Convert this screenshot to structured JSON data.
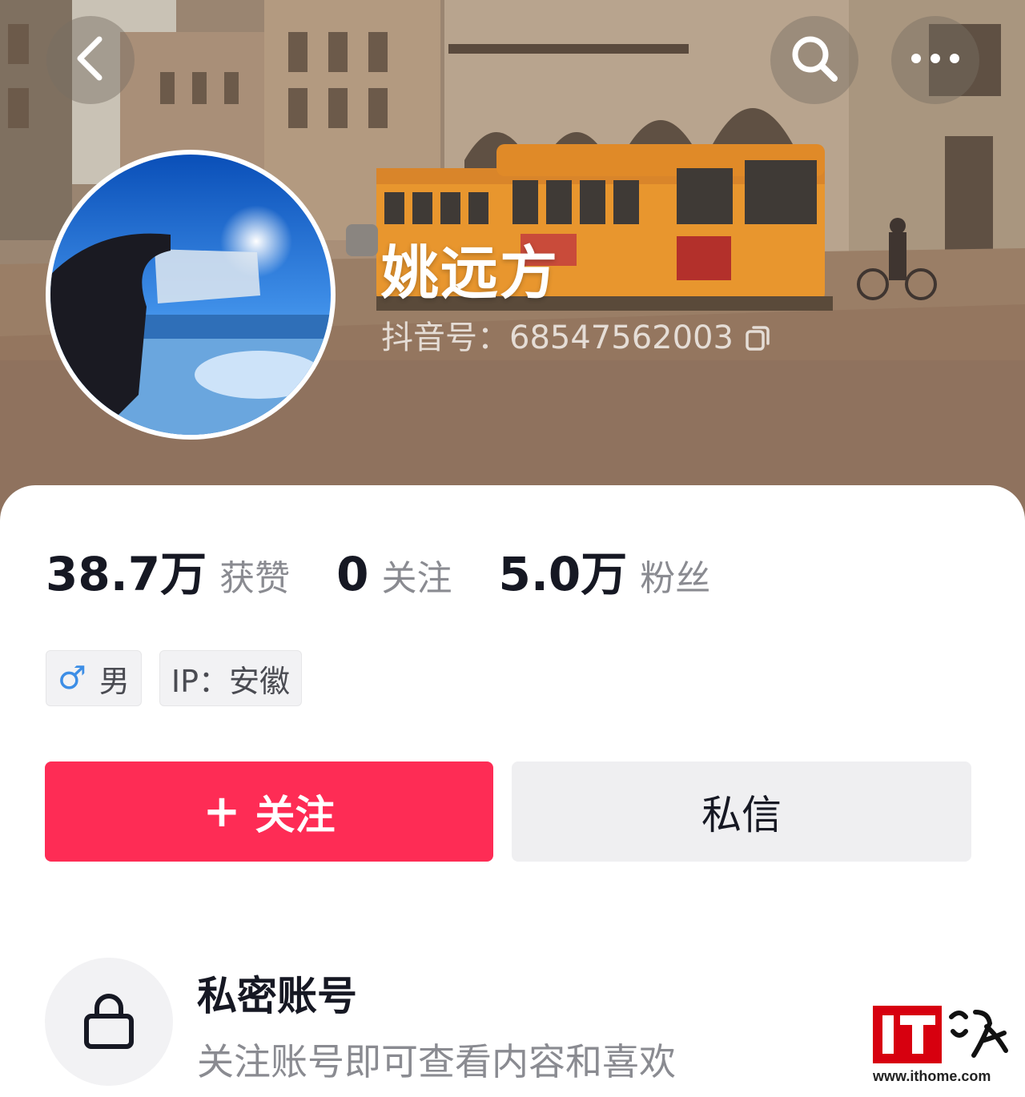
{
  "header": {
    "back_icon": "chevron-left-icon",
    "search_icon": "search-icon",
    "more_icon": "more-dots-icon"
  },
  "profile": {
    "nickname": "姚远方",
    "douyin_id": "抖音号：68547562003",
    "copy_icon": "copy-icon"
  },
  "stats": [
    {
      "value": "38.7万",
      "label": "获赞"
    },
    {
      "value": "0",
      "label": "关注"
    },
    {
      "value": "5.0万",
      "label": "粉丝"
    }
  ],
  "tags": {
    "gender_symbol": "♂",
    "gender": "男",
    "ip": "IP：安徽"
  },
  "actions": {
    "follow_plus": "+",
    "follow_label": "关注",
    "message_label": "私信"
  },
  "private_notice": {
    "icon": "lock-icon",
    "title": "私密账号",
    "description": "关注账号即可查看内容和喜欢"
  },
  "watermark": {
    "url": "www.ithome.com"
  },
  "colors": {
    "accent": "#fe2c55",
    "text_primary": "#161823",
    "text_secondary": "#8a8b91",
    "tram": "#e8962e"
  }
}
